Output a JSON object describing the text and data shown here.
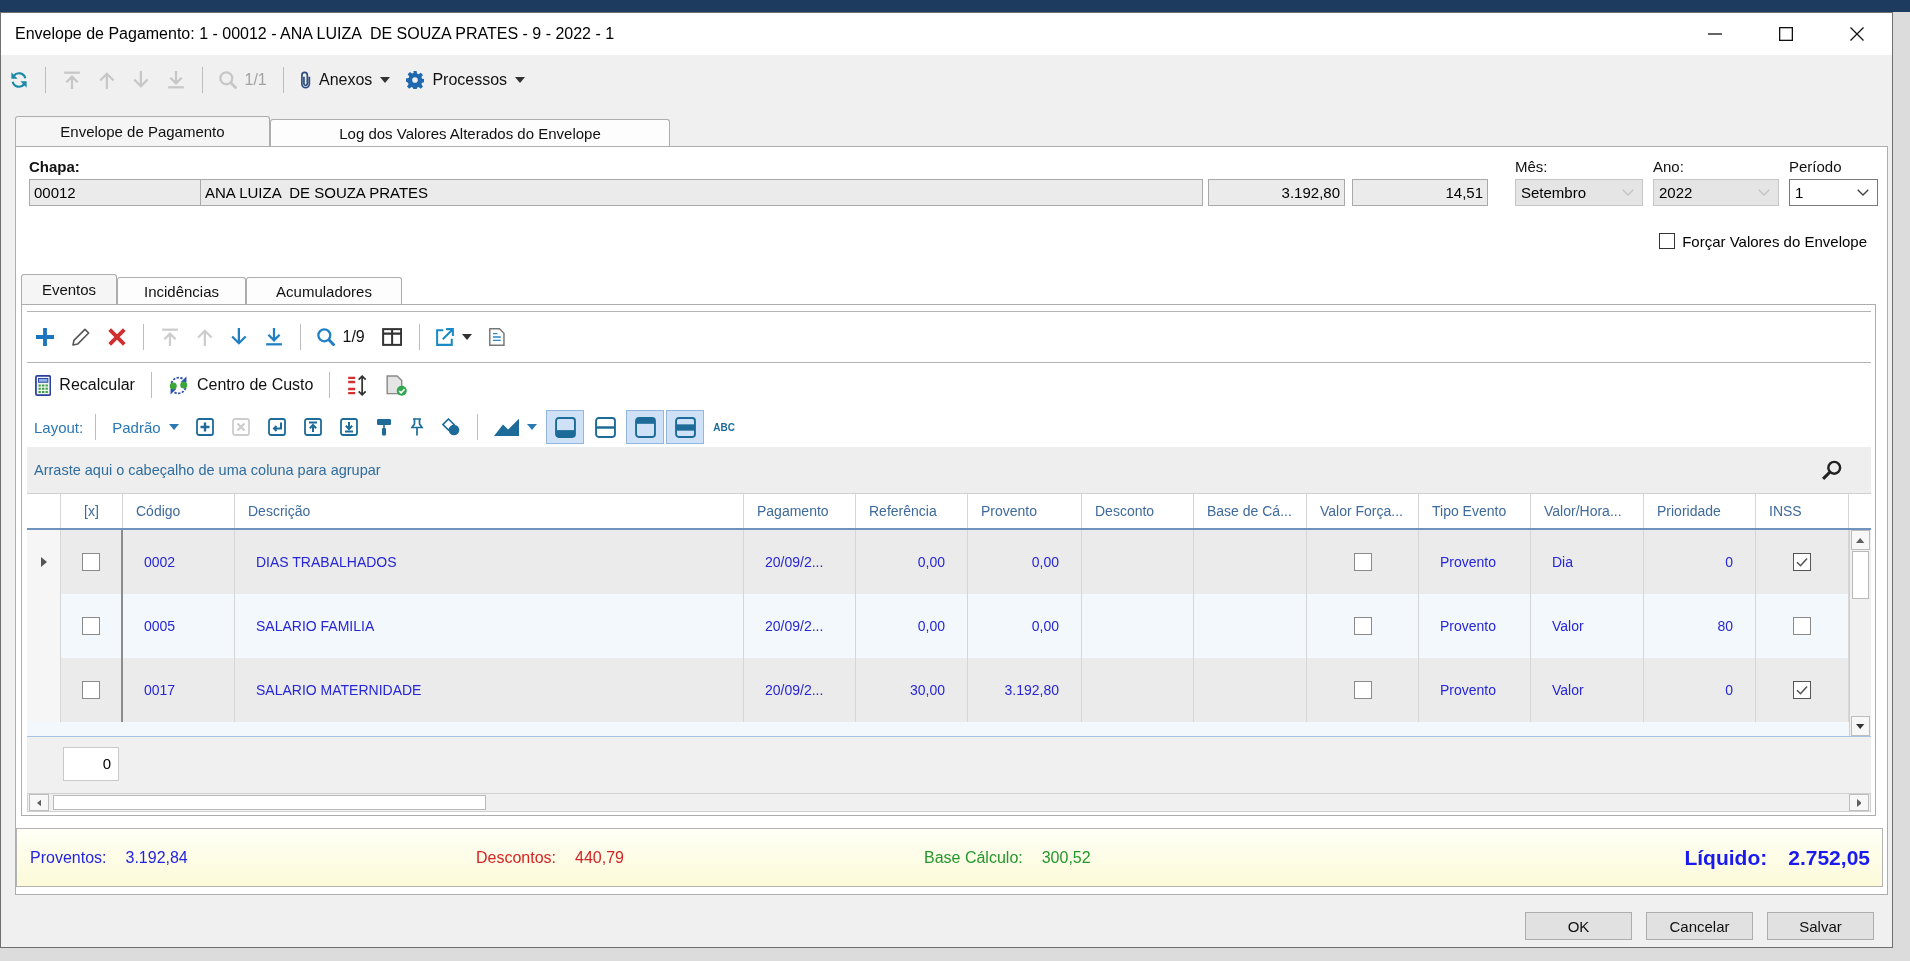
{
  "window": {
    "title": "Envelope de Pagamento: 1 - 00012 - ANA LUIZA  DE SOUZA PRATES - 9 - 2022 - 1"
  },
  "main_toolbar": [
    [
      {
        "disabled": false
      }
    ],
    [
      {
        "disabled": true
      },
      {
        "disabled": true
      },
      {
        "disabled": true
      },
      {
        "disabled": true
      }
    ],
    [
      {
        "label": "1/1",
        "disabled": true
      }
    ],
    [
      {
        "label": "Anexos",
        "disabled": false
      },
      {
        "label": "Processos",
        "disabled": false
      }
    ]
  ],
  "tabs": [
    {
      "label": "Envelope de Pagamento",
      "selected": true
    },
    {
      "label": "Log dos Valores Alterados do Envelope",
      "selected": false
    }
  ],
  "employee": {
    "label": "Chapa:",
    "id": "00012",
    "name": "ANA LUIZA  DE SOUZA PRATES",
    "field_3": "3.192,80",
    "field_4": "14,51"
  },
  "period": [
    {
      "label": "Mês:",
      "value": "Setembro",
      "disabled": true
    },
    {
      "label": "Ano:",
      "value": "2022",
      "disabled": true
    },
    {
      "label": "Período",
      "value": "1",
      "disabled": false
    }
  ],
  "force_values": {
    "label": "Forçar Valores do Envelope",
    "checked": false
  },
  "inner_tabs": [
    {
      "label": "Eventos",
      "selected": true
    },
    {
      "label": "Incidências",
      "selected": false
    },
    {
      "label": "Acumuladores",
      "selected": false
    }
  ],
  "grid_toolbar": [
    [
      {
        "disabled": false
      },
      {
        "disabled": false
      },
      {
        "disabled": false
      }
    ],
    [
      {
        "disabled": true
      },
      {
        "disabled": true
      },
      {
        "disabled": false
      },
      {
        "disabled": false
      }
    ],
    [
      {
        "label": "1/9",
        "disabled": false
      },
      {
        "disabled": false
      }
    ],
    [
      {
        "disabled": false
      },
      {
        "disabled": false
      }
    ]
  ],
  "actions_toolbar": [
    [
      {
        "label": "Recalcular",
        "disabled": false
      }
    ],
    [
      {
        "label": "Centro de Custo",
        "disabled": false
      }
    ],
    [
      {
        "disabled": false
      },
      {
        "disabled": false
      }
    ]
  ],
  "layout_toolbar": {
    "label": "Layout:",
    "groups": [
      [
        {
          "kind": "menu",
          "label": "Padrão",
          "disabled": false
        },
        {
          "kind": "button",
          "disabled": false
        },
        {
          "kind": "button",
          "disabled": true
        },
        {
          "kind": "button",
          "disabled": false
        },
        {
          "kind": "button",
          "disabled": false
        },
        {
          "kind": "button",
          "disabled": false
        },
        {
          "kind": "button",
          "disabled": false
        },
        {
          "kind": "button",
          "disabled": false
        },
        {
          "kind": "button",
          "disabled": false
        }
      ],
      [
        {
          "kind": "menu",
          "disabled": false
        },
        {
          "kind": "toggle",
          "selected": true,
          "disabled": false
        },
        {
          "kind": "toggle",
          "selected": false,
          "disabled": false
        },
        {
          "kind": "toggle",
          "selected": true,
          "disabled": false
        },
        {
          "kind": "toggle",
          "selected": true,
          "disabled": false
        },
        {
          "kind": "text",
          "label": "ABC",
          "disabled": false
        }
      ]
    ]
  },
  "group_panel": {
    "hint": "Arraste aqui o cabeçalho de uma coluna para agrupar"
  },
  "grid": {
    "columns": [
      "[x]",
      "Código",
      "Descrição",
      "Pagamento",
      "Referência",
      "Provento",
      "Desconto",
      "Base de Cá...",
      "Valor Força...",
      "Tipo Evento",
      "Valor/Hora...",
      "Prioridade",
      "INSS"
    ],
    "rows": [
      {
        "current": true,
        "marked": false,
        "code": "0002",
        "description": "DIAS TRABALHADOS",
        "payment": "20/09/2...",
        "reference": "0,00",
        "earning": "0,00",
        "forced": false,
        "event_type": "Provento",
        "value_hour": "Dia",
        "priority": "0",
        "inss": true
      },
      {
        "current": false,
        "marked": false,
        "code": "0005",
        "description": "SALARIO FAMILIA",
        "payment": "20/09/2...",
        "reference": "0,00",
        "earning": "0,00",
        "forced": false,
        "event_type": "Provento",
        "value_hour": "Valor",
        "priority": "80",
        "inss": false
      },
      {
        "current": false,
        "marked": false,
        "code": "0017",
        "description": "SALARIO MATERNIDADE",
        "payment": "20/09/2...",
        "reference": "30,00",
        "earning": "3.192,80",
        "forced": false,
        "event_type": "Provento",
        "value_hour": "Valor",
        "priority": "0",
        "inss": true
      }
    ],
    "footer_value": "0"
  },
  "totals": {
    "items": [
      {
        "label": "Proventos:",
        "value": "3.192,84",
        "color": "#2424e0"
      },
      {
        "label": "Descontos:",
        "value": "440,79",
        "color": "#d42424"
      },
      {
        "label": "Base Cálculo:",
        "value": "300,52",
        "color": "#24962c"
      }
    ],
    "net": {
      "label": "Líquido:",
      "value": "2.752,05"
    }
  },
  "buttons": [
    "OK",
    "Cancelar",
    "Salvar"
  ]
}
